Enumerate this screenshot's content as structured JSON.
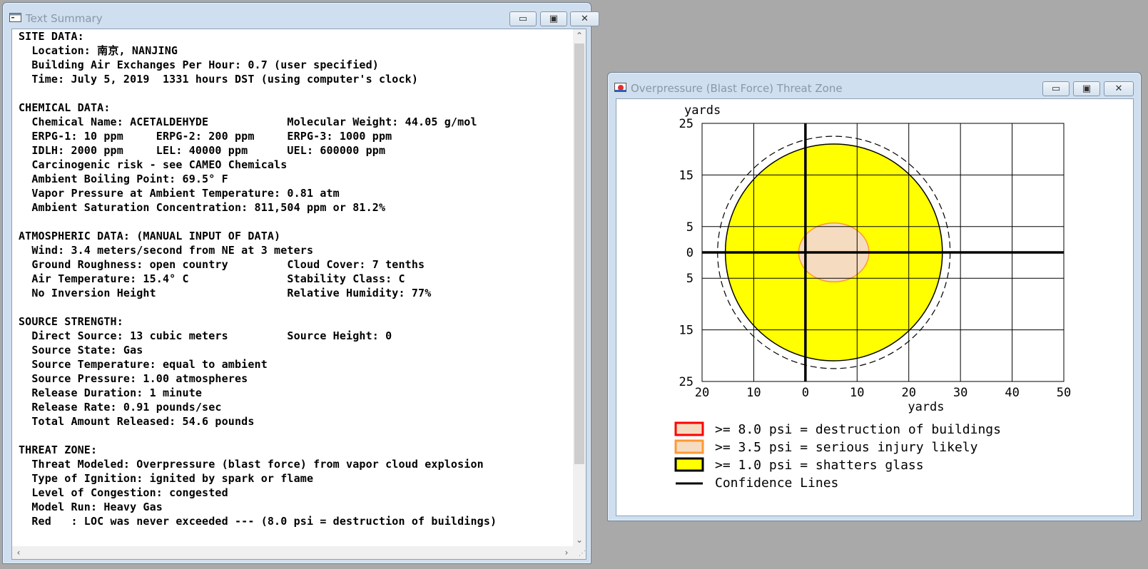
{
  "summary_window": {
    "title": "Text Summary",
    "controls": {
      "minimize": "▭",
      "maximize": "▣",
      "close": "✕"
    },
    "lines": [
      "SITE DATA:",
      "  Location: 南京, NANJING",
      "  Building Air Exchanges Per Hour: 0.7 (user specified)",
      "  Time: July 5, 2019  1331 hours DST (using computer's clock)",
      "",
      "CHEMICAL DATA:",
      "  Chemical Name: ACETALDEHYDE            Molecular Weight: 44.05 g/mol",
      "  ERPG-1: 10 ppm     ERPG-2: 200 ppm     ERPG-3: 1000 ppm",
      "  IDLH: 2000 ppm     LEL: 40000 ppm      UEL: 600000 ppm",
      "  Carcinogenic risk - see CAMEO Chemicals",
      "  Ambient Boiling Point: 69.5° F",
      "  Vapor Pressure at Ambient Temperature: 0.81 atm",
      "  Ambient Saturation Concentration: 811,504 ppm or 81.2%",
      "",
      "ATMOSPHERIC DATA: (MANUAL INPUT OF DATA)",
      "  Wind: 3.4 meters/second from NE at 3 meters",
      "  Ground Roughness: open country         Cloud Cover: 7 tenths",
      "  Air Temperature: 15.4° C               Stability Class: C",
      "  No Inversion Height                    Relative Humidity: 77%",
      "",
      "SOURCE STRENGTH:",
      "  Direct Source: 13 cubic meters         Source Height: 0",
      "  Source State: Gas",
      "  Source Temperature: equal to ambient",
      "  Source Pressure: 1.00 atmospheres",
      "  Release Duration: 1 minute",
      "  Release Rate: 0.91 pounds/sec",
      "  Total Amount Released: 54.6 pounds",
      "",
      "THREAT ZONE:",
      "  Threat Modeled: Overpressure (blast force) from vapor cloud explosion",
      "  Type of Ignition: ignited by spark or flame",
      "  Level of Congestion: congested",
      "  Model Run: Heavy Gas",
      "  Red   : LOC was never exceeded --- (8.0 psi = destruction of buildings)"
    ]
  },
  "plot_window": {
    "title": "Overpressure (Blast Force) Threat Zone",
    "controls": {
      "minimize": "▭",
      "maximize": "▣",
      "close": "✕"
    }
  },
  "colors": {
    "glass_zone": "#ffff00",
    "injury_zone": "#f5dcc0",
    "injury_outline": "#ff9933",
    "destruction_outline": "#ff0000",
    "window_frame": "#cfdfef"
  },
  "chart_data": {
    "type": "area",
    "xlabel": "yards",
    "ylabel": "yards",
    "xlim": [
      -20,
      50
    ],
    "ylim": [
      -25,
      25
    ],
    "x_ticks": [
      -20,
      -10,
      0,
      10,
      20,
      30,
      40,
      50
    ],
    "x_tick_labels": [
      "20",
      "10",
      "0",
      "10",
      "20",
      "30",
      "40",
      "50"
    ],
    "y_ticks": [
      25,
      15,
      5,
      0,
      -5,
      -15,
      -25
    ],
    "y_tick_labels": [
      "25",
      "15",
      "5",
      "0",
      "5",
      "15",
      "25"
    ],
    "grid": true,
    "zones": [
      {
        "name": ">= 1.0 psi = shatters glass",
        "center": [
          5.5,
          0
        ],
        "rx": 21,
        "ry": 21
      },
      {
        "name": ">= 3.5 psi = serious injury likely",
        "center": [
          5.5,
          0
        ],
        "rx": 6.8,
        "ry": 5.7
      }
    ],
    "confidence_line": {
      "center": [
        5.5,
        0
      ],
      "rx": 22.5,
      "ry": 22.5
    },
    "legend": [
      {
        "label": ">= 8.0 psi = destruction of buildings",
        "kind": "destruction"
      },
      {
        "label": ">= 3.5 psi = serious injury likely",
        "kind": "injury"
      },
      {
        "label": ">= 1.0 psi = shatters glass",
        "kind": "glass"
      },
      {
        "label": "Confidence Lines",
        "kind": "line"
      }
    ]
  }
}
